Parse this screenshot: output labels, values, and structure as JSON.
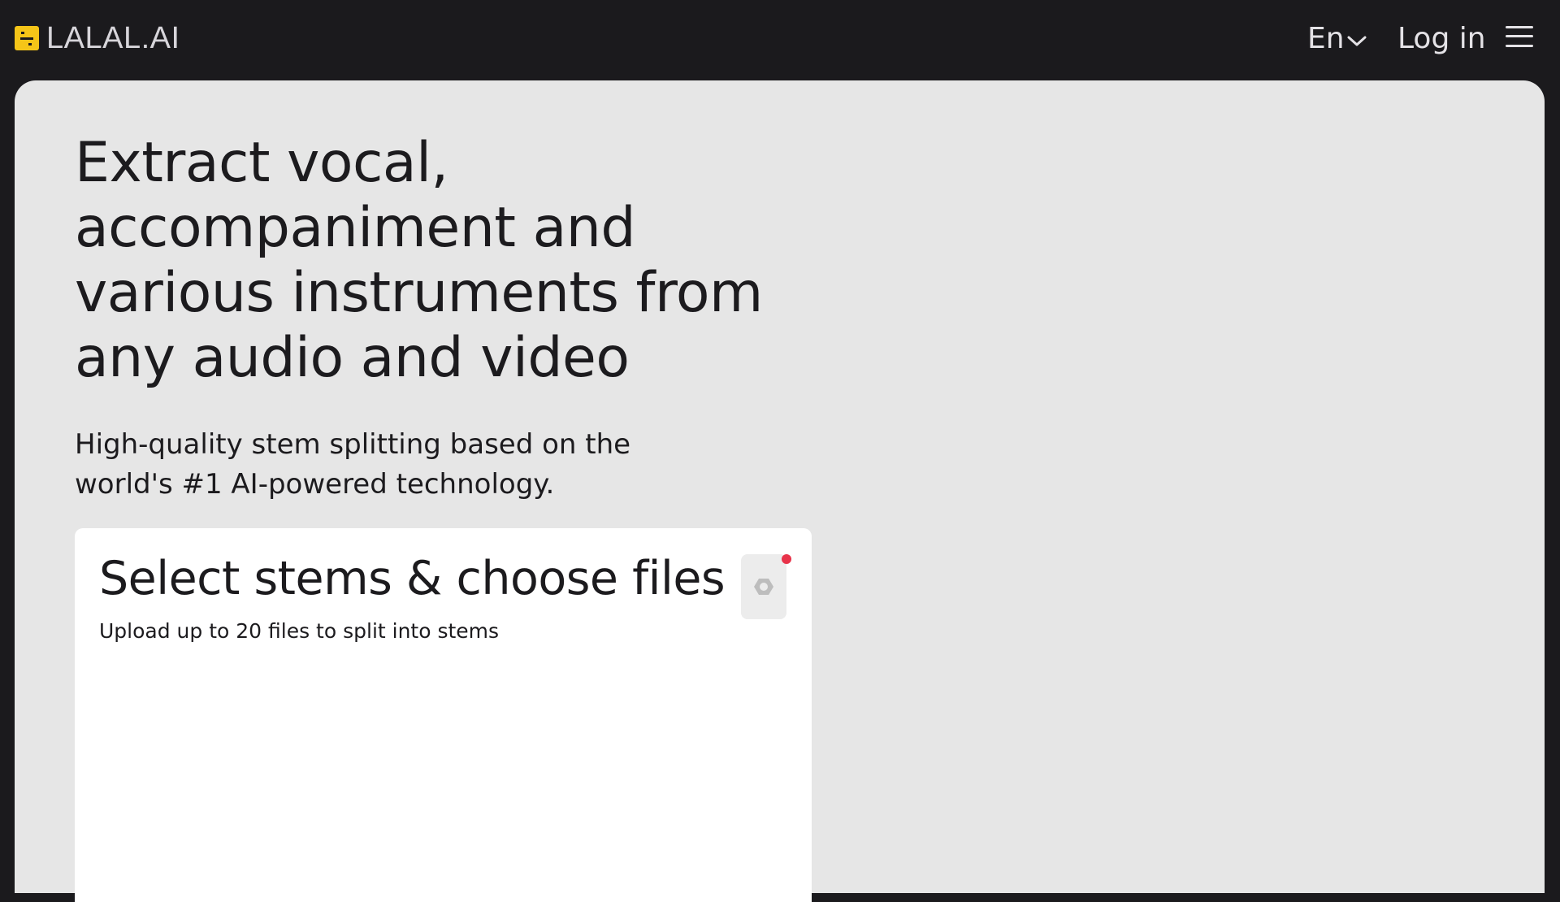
{
  "header": {
    "logo_text": "LALAL.AI",
    "language_label": "En",
    "login_label": "Log in",
    "menu_icon": "hamburger-menu-icon",
    "chevron_icon": "chevron-down-icon"
  },
  "hero": {
    "headline": "Extract vocal, accompaniment and various instruments from any audio and video",
    "subheadline": "High-quality stem splitting based on the world's #1 AI-powered technology."
  },
  "upload_card": {
    "title": "Select stems & choose files",
    "subtitle": "Upload up to 20 files to split into stems",
    "settings_icon": "settings-hexagon-icon",
    "has_notification": true
  },
  "colors": {
    "header_bg": "#1b1a1d",
    "panel_bg": "#e6e6e6",
    "card_bg": "#ffffff",
    "logo_accent": "#f5c518",
    "notification_dot": "#e8334a",
    "text_dark": "#1c1b1e",
    "text_light": "#e4e2e6"
  }
}
